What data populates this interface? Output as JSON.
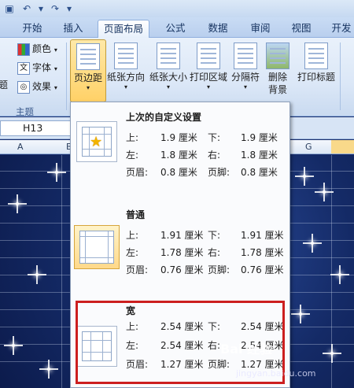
{
  "tabs": [
    "开始",
    "插入",
    "页面布局",
    "公式",
    "数据",
    "审阅",
    "视图",
    "开发"
  ],
  "active_tab": "页面布局",
  "theme_group": {
    "items": [
      "颜色",
      "字体",
      "效果"
    ],
    "partial_label": "题",
    "label": "主题"
  },
  "ribbon_buttons": [
    "页边距",
    "纸张方向",
    "纸张大小",
    "打印区域",
    "分隔符",
    "删除\n背景",
    "打印标题"
  ],
  "name_box": "H13",
  "columns": [
    "A",
    "B",
    "G"
  ],
  "margins_menu": [
    {
      "title": "上次的自定义设置",
      "rows": [
        [
          "上:",
          "1.9 厘米",
          "下:",
          "1.9 厘米"
        ],
        [
          "左:",
          "1.8 厘米",
          "右:",
          "1.8 厘米"
        ],
        [
          "页眉:",
          "0.8 厘米",
          "页脚:",
          "0.8 厘米"
        ]
      ]
    },
    {
      "title": "普通",
      "rows": [
        [
          "上:",
          "1.91 厘米",
          "下:",
          "1.91 厘米"
        ],
        [
          "左:",
          "1.78 厘米",
          "右:",
          "1.78 厘米"
        ],
        [
          "页眉:",
          "0.76 厘米",
          "页脚:",
          "0.76 厘米"
        ]
      ]
    },
    {
      "title": "宽",
      "rows": [
        [
          "上:",
          "2.54 厘米",
          "下:",
          "2.54 厘米"
        ],
        [
          "左:",
          "2.54 厘米",
          "右:",
          "2.54 厘米"
        ],
        [
          "页眉:",
          "1.27 厘米",
          "页脚:",
          "1.27 厘米"
        ]
      ]
    }
  ],
  "watermark": "Bai 经验",
  "watermark_url": "jingyan.baidu.com"
}
